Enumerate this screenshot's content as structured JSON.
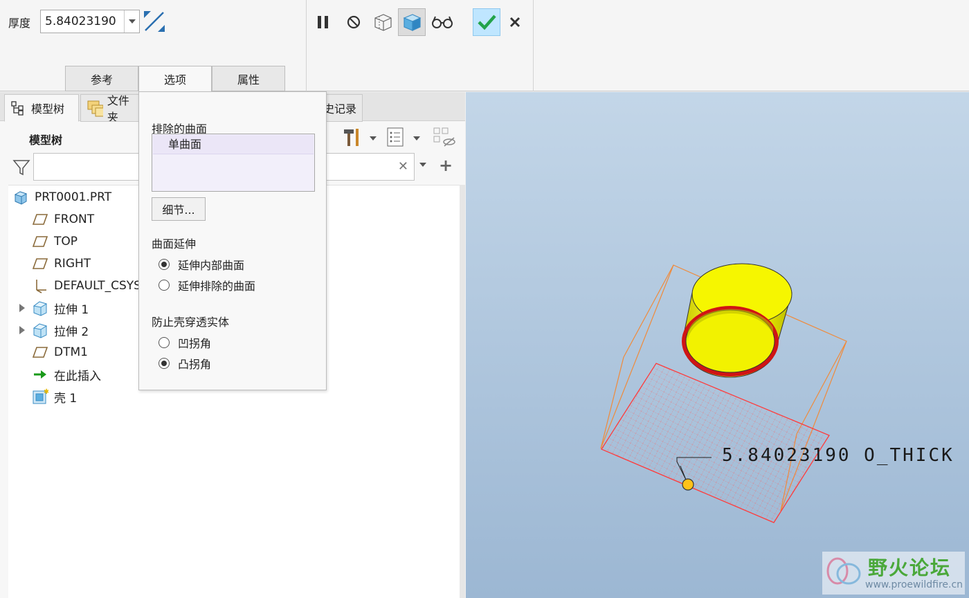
{
  "ribbon": {
    "thickness_label": "厚度",
    "thickness_value": "5.84023190",
    "tabs": [
      "参考",
      "选项",
      "属性"
    ],
    "active_tab": "选项"
  },
  "left_panel": {
    "tabs": {
      "model_tree": "模型树",
      "folder_browser_partial": "文件夹",
      "history_partial": "史记录"
    },
    "tree_title": "模型树",
    "tree": [
      {
        "label": "PRT0001.PRT",
        "icon": "part-icon"
      },
      {
        "label": "FRONT",
        "icon": "datum-plane-icon"
      },
      {
        "label": "TOP",
        "icon": "datum-plane-icon"
      },
      {
        "label": "RIGHT",
        "icon": "datum-plane-icon"
      },
      {
        "label": "DEFAULT_CSYS",
        "icon": "csys-icon"
      },
      {
        "label": "拉伸 1",
        "icon": "extrude-icon"
      },
      {
        "label": "拉伸 2",
        "icon": "extrude-icon"
      },
      {
        "label": "DTM1",
        "icon": "datum-plane-icon"
      },
      {
        "label": "在此插入",
        "icon": "insert-arrow-icon"
      },
      {
        "label": "壳 1",
        "icon": "shell-icon"
      }
    ]
  },
  "options_popup": {
    "excluded_surfaces_label": "排除的曲面",
    "excluded_surfaces_items": [
      "单曲面"
    ],
    "details_button": "细节...",
    "surface_extend_label": "曲面延伸",
    "surface_extend_options": [
      "延伸内部曲面",
      "延伸排除的曲面"
    ],
    "surface_extend_selected": 0,
    "prevent_label": "防止壳穿透实体",
    "prevent_options": [
      "凹拐角",
      "凸拐角"
    ],
    "prevent_selected": 1
  },
  "viewport": {
    "dimension_text": "5.84023190 O_THICK",
    "watermark_name": "野火论坛",
    "watermark_url": "www.proewildfire.cn"
  },
  "colors": {
    "accent_ok": "#22a34a",
    "model_yellow": "#ffff00",
    "shell_red": "#d21414",
    "bbox_orange": "#f08a3a"
  }
}
